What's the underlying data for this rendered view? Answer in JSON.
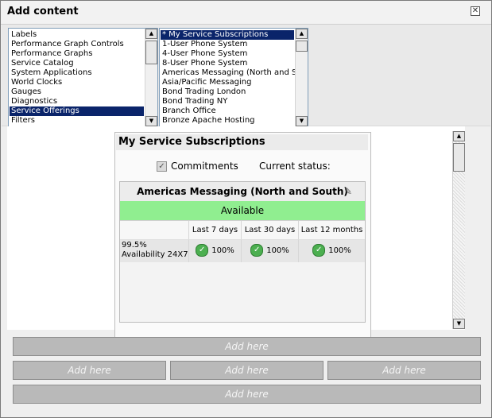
{
  "dialog": {
    "title": "Add content"
  },
  "categories": {
    "items": [
      {
        "label": "Labels",
        "selected": false
      },
      {
        "label": "Performance Graph Controls",
        "selected": false
      },
      {
        "label": "Performance Graphs",
        "selected": false
      },
      {
        "label": "Service Catalog",
        "selected": false
      },
      {
        "label": "System Applications",
        "selected": false
      },
      {
        "label": "World Clocks",
        "selected": false
      },
      {
        "label": "Gauges",
        "selected": false
      },
      {
        "label": "Diagnostics",
        "selected": false
      },
      {
        "label": "Service Offerings",
        "selected": true
      },
      {
        "label": "Filters",
        "selected": false
      }
    ]
  },
  "offerings": {
    "items": [
      {
        "label": "* My Service Subscriptions",
        "selected": true
      },
      {
        "label": "1-User Phone System",
        "selected": false
      },
      {
        "label": "4-User Phone System",
        "selected": false
      },
      {
        "label": "8-User Phone System",
        "selected": false
      },
      {
        "label": "Americas Messaging (North and South)",
        "selected": false
      },
      {
        "label": "Asia/Pacific Messaging",
        "selected": false
      },
      {
        "label": "Bond Trading London",
        "selected": false
      },
      {
        "label": "Bond Trading NY",
        "selected": false
      },
      {
        "label": "Branch Office",
        "selected": false
      },
      {
        "label": "Bronze Apache Hosting",
        "selected": false
      }
    ]
  },
  "preview": {
    "widget_title": "My Service Subscriptions",
    "commitments_label": "Commitments",
    "current_status_label": "Current status:",
    "service_name": "Americas Messaging (North and South)",
    "availability_status": "Available",
    "columns": [
      "Last 7 days",
      "Last 30 days",
      "Last 12 months"
    ],
    "metric_label_line1": "99.5%",
    "metric_label_line2": "Availability 24X7",
    "values": [
      "100%",
      "100%",
      "100%"
    ]
  },
  "add_here": {
    "label": "Add here"
  },
  "colors": {
    "available_green": "#90ee90",
    "selected_blue": "#0a246a",
    "add_here_gray": "#b9b9b9"
  },
  "icons": [
    "close-icon",
    "pencil-icon",
    "check-circle-icon",
    "scroll-up-icon",
    "scroll-down-icon"
  ]
}
